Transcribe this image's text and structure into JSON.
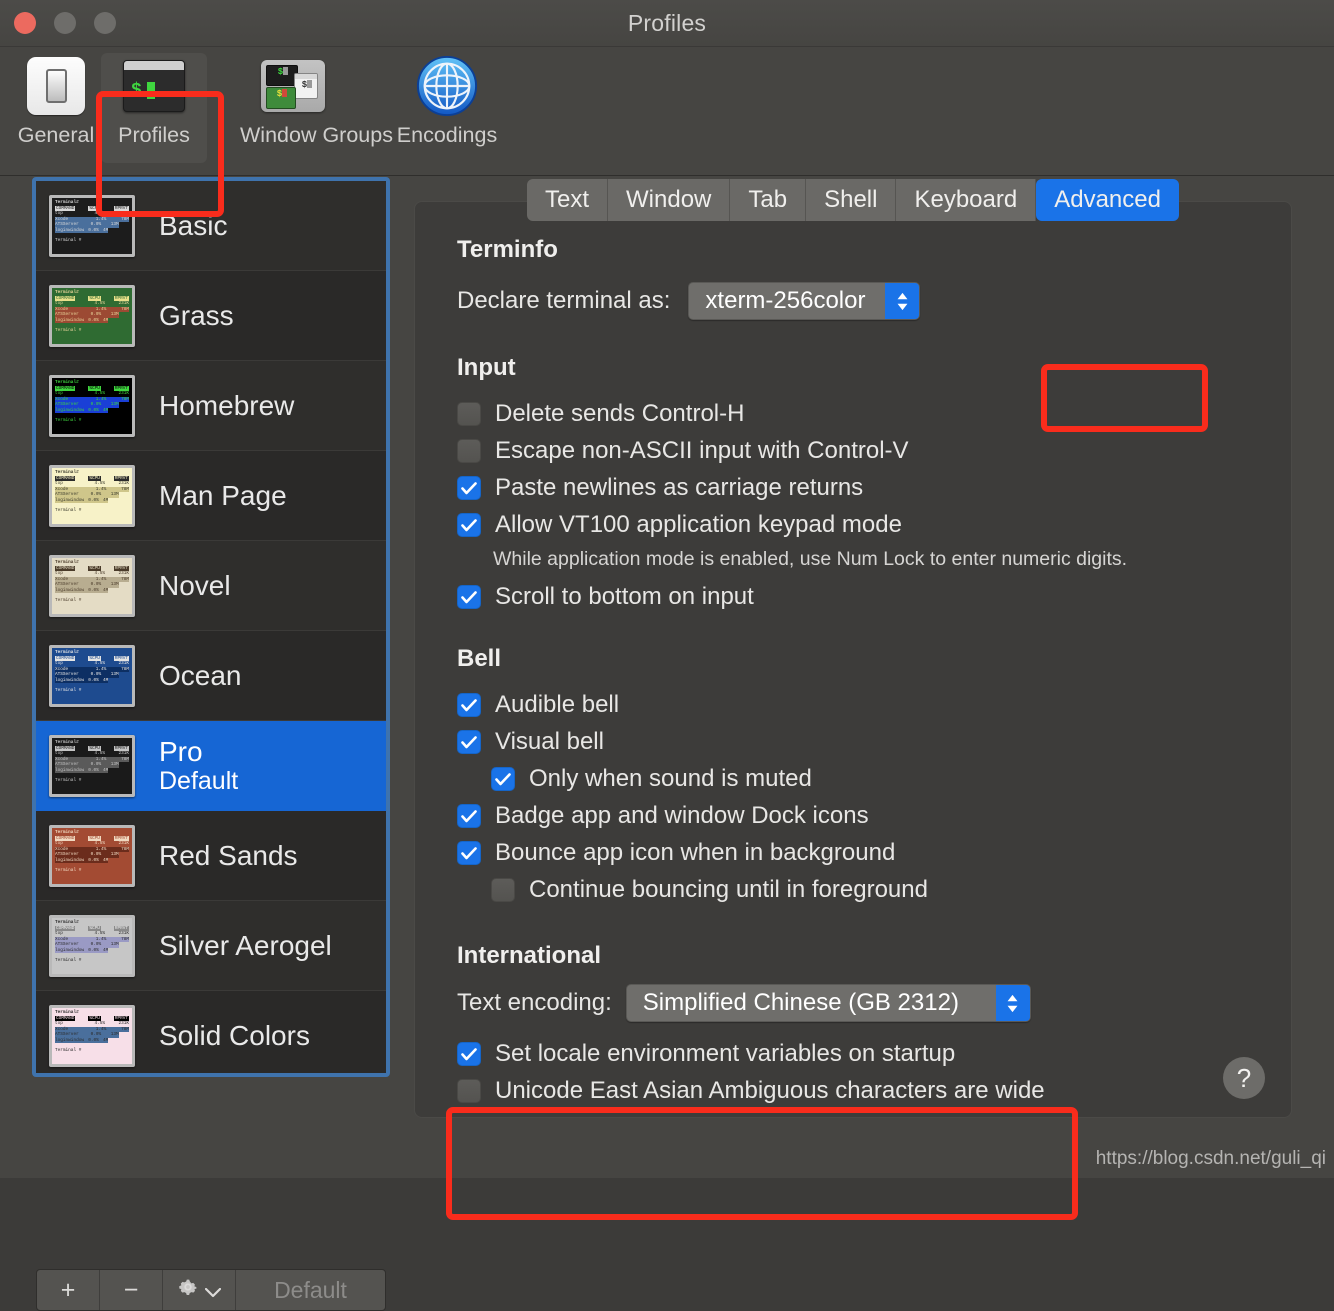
{
  "window": {
    "title": "Profiles",
    "traffic_lights": [
      "close-button",
      "minimize-button",
      "zoom-button"
    ]
  },
  "toolbar": {
    "items": [
      {
        "label": "General",
        "icon": "general-switch-icon",
        "active": false
      },
      {
        "label": "Profiles",
        "icon": "terminal-window-icon",
        "active": true
      },
      {
        "label": "Window Groups",
        "icon": "window-groups-icon",
        "active": false
      },
      {
        "label": "Encodings",
        "icon": "globe-icon",
        "active": false
      }
    ]
  },
  "sidebar": {
    "profiles": [
      {
        "name": "Basic",
        "subtitle": "",
        "selected": false,
        "theme": {
          "bg": "#1c1c1c",
          "fg": "#d8d8d8",
          "accent": "#4a6f9c",
          "hdr_bg": "#d8d8d8",
          "hdr_fg": "#1c1c1c"
        }
      },
      {
        "name": "Grass",
        "subtitle": "",
        "selected": false,
        "theme": {
          "bg": "#2f6b32",
          "fg": "#e8d49a",
          "accent": "#9c4a33",
          "hdr_bg": "#e8e08a",
          "hdr_fg": "#2f6b32"
        }
      },
      {
        "name": "Homebrew",
        "subtitle": "",
        "selected": false,
        "theme": {
          "bg": "#000000",
          "fg": "#3fd63f",
          "accent": "#1a3fd6",
          "hdr_bg": "#3fd63f",
          "hdr_fg": "#000000"
        }
      },
      {
        "name": "Man Page",
        "subtitle": "",
        "selected": false,
        "theme": {
          "bg": "#f7f2c8",
          "fg": "#3a3a2c",
          "accent": "#cfc68a",
          "hdr_bg": "#2c2c2c",
          "hdr_fg": "#f7f2c8"
        }
      },
      {
        "name": "Novel",
        "subtitle": "",
        "selected": false,
        "theme": {
          "bg": "#e4dcc5",
          "fg": "#4a3b2a",
          "accent": "#b8ad90",
          "hdr_bg": "#4a3b2a",
          "hdr_fg": "#e4dcc5"
        }
      },
      {
        "name": "Ocean",
        "subtitle": "",
        "selected": false,
        "theme": {
          "bg": "#1e4b8f",
          "fg": "#e4e4e4",
          "accent": "#0d2f63",
          "hdr_bg": "#e4e4e4",
          "hdr_fg": "#1e4b8f"
        }
      },
      {
        "name": "Pro",
        "subtitle": "Default",
        "selected": true,
        "theme": {
          "bg": "#1a1a1a",
          "fg": "#c4c4c4",
          "accent": "#5a5a5a",
          "hdr_bg": "#c4c4c4",
          "hdr_fg": "#1a1a1a"
        }
      },
      {
        "name": "Red Sands",
        "subtitle": "",
        "selected": false,
        "theme": {
          "bg": "#a34b33",
          "fg": "#f0d8c0",
          "accent": "#6b2c1c",
          "hdr_bg": "#f0d8c0",
          "hdr_fg": "#a34b33"
        }
      },
      {
        "name": "Silver Aerogel",
        "subtitle": "",
        "selected": false,
        "theme": {
          "bg": "#c6c6c6",
          "fg": "#2c2c2c",
          "accent": "#9a9ac4",
          "hdr_bg": "#8a8a8a",
          "hdr_fg": "#f0f0f0"
        }
      },
      {
        "name": "Solid Colors",
        "subtitle": "",
        "selected": false,
        "theme": {
          "bg": "#f7dfe8",
          "fg": "#2c2c2c",
          "accent": "#4a6f9c",
          "hdr_bg": "#000000",
          "hdr_fg": "#f7dfe8"
        }
      }
    ],
    "thumbnail_text": {
      "header": "Terminal#",
      "columns": [
        "COMMAND",
        "%CPU",
        "RPRVT"
      ],
      "rows": [
        [
          "top",
          "4.5%",
          "231K"
        ],
        [
          "Xcode",
          "1.4%",
          "78M"
        ],
        [
          "ATSServer",
          "0.0%",
          "13M"
        ],
        [
          "loginwindow",
          "0.0%",
          "4M"
        ]
      ],
      "footer": "Terminal #"
    },
    "toolbar": {
      "add_label": "+",
      "remove_label": "−",
      "gear_label": "gear",
      "default_label": "Default"
    }
  },
  "tabs": [
    {
      "label": "Text",
      "active": false
    },
    {
      "label": "Window",
      "active": false
    },
    {
      "label": "Tab",
      "active": false
    },
    {
      "label": "Shell",
      "active": false
    },
    {
      "label": "Keyboard",
      "active": false
    },
    {
      "label": "Advanced",
      "active": true
    }
  ],
  "advanced": {
    "terminfo": {
      "section_title": "Terminfo",
      "declare_label": "Declare terminal as:",
      "declare_value": "xterm-256color"
    },
    "input": {
      "section_title": "Input",
      "options": [
        {
          "label": "Delete sends Control-H",
          "checked": false,
          "indent": false
        },
        {
          "label": "Escape non-ASCII input with Control-V",
          "checked": false,
          "indent": false
        },
        {
          "label": "Paste newlines as carriage returns",
          "checked": true,
          "indent": false
        },
        {
          "label": "Allow VT100 application keypad mode",
          "checked": true,
          "indent": false
        }
      ],
      "note": "While application mode is enabled, use Num Lock to enter numeric digits.",
      "options_after_note": [
        {
          "label": "Scroll to bottom on input",
          "checked": true,
          "indent": false
        }
      ]
    },
    "bell": {
      "section_title": "Bell",
      "options": [
        {
          "label": "Audible bell",
          "checked": true,
          "indent": false
        },
        {
          "label": "Visual bell",
          "checked": true,
          "indent": false
        },
        {
          "label": "Only when sound is muted",
          "checked": true,
          "indent": true
        },
        {
          "label": "Badge app and window Dock icons",
          "checked": true,
          "indent": false
        },
        {
          "label": "Bounce app icon when in background",
          "checked": true,
          "indent": false
        },
        {
          "label": "Continue bouncing until in foreground",
          "checked": false,
          "indent": true
        }
      ]
    },
    "international": {
      "section_title": "International",
      "encoding_label": "Text encoding:",
      "encoding_value": "Simplified Chinese (GB 2312)",
      "options": [
        {
          "label": "Set locale environment variables on startup",
          "checked": true,
          "indent": false
        },
        {
          "label": "Unicode East Asian Ambiguous characters are wide",
          "checked": false,
          "indent": false
        }
      ]
    },
    "help_label": "?"
  },
  "highlights": {
    "accent_color": "#f92c1c",
    "targets": [
      "toolbar-item-profiles",
      "tab-advanced",
      "international-section"
    ]
  },
  "watermark": "https://blog.csdn.net/guli_qi"
}
